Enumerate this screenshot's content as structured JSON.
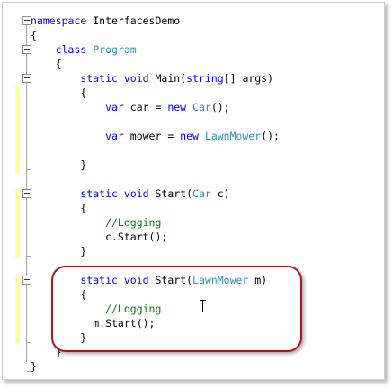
{
  "editor": {
    "lines": [
      {
        "parts": [
          {
            "t": "namespace",
            "c": "kw"
          },
          {
            "t": " InterfacesDemo",
            "c": "plain"
          }
        ]
      },
      {
        "parts": [
          {
            "t": "{",
            "c": "plain"
          }
        ]
      },
      {
        "parts": [
          {
            "t": "    class",
            "c": "kw"
          },
          {
            "t": " ",
            "c": "plain"
          },
          {
            "t": "Program",
            "c": "type"
          }
        ]
      },
      {
        "parts": [
          {
            "t": "    {",
            "c": "plain"
          }
        ]
      },
      {
        "parts": [
          {
            "t": "        static",
            "c": "kw"
          },
          {
            "t": " ",
            "c": "plain"
          },
          {
            "t": "void",
            "c": "kw"
          },
          {
            "t": " Main(",
            "c": "plain"
          },
          {
            "t": "string",
            "c": "kw"
          },
          {
            "t": "[] args)",
            "c": "plain"
          }
        ]
      },
      {
        "parts": [
          {
            "t": "        {",
            "c": "plain"
          }
        ]
      },
      {
        "parts": [
          {
            "t": "            var",
            "c": "kw"
          },
          {
            "t": " car = ",
            "c": "plain"
          },
          {
            "t": "new",
            "c": "kw"
          },
          {
            "t": " ",
            "c": "plain"
          },
          {
            "t": "Car",
            "c": "type"
          },
          {
            "t": "();",
            "c": "plain"
          }
        ]
      },
      {
        "parts": [
          {
            "t": "",
            "c": "plain"
          }
        ]
      },
      {
        "parts": [
          {
            "t": "            var",
            "c": "kw"
          },
          {
            "t": " mower = ",
            "c": "plain"
          },
          {
            "t": "new",
            "c": "kw"
          },
          {
            "t": " ",
            "c": "plain"
          },
          {
            "t": "LawnMower",
            "c": "type"
          },
          {
            "t": "();",
            "c": "plain"
          }
        ]
      },
      {
        "parts": [
          {
            "t": "",
            "c": "plain"
          }
        ]
      },
      {
        "parts": [
          {
            "t": "        }",
            "c": "plain"
          }
        ]
      },
      {
        "parts": [
          {
            "t": "",
            "c": "plain"
          }
        ]
      },
      {
        "parts": [
          {
            "t": "        static",
            "c": "kw"
          },
          {
            "t": " ",
            "c": "plain"
          },
          {
            "t": "void",
            "c": "kw"
          },
          {
            "t": " Start(",
            "c": "plain"
          },
          {
            "t": "Car",
            "c": "type"
          },
          {
            "t": " c)",
            "c": "plain"
          }
        ]
      },
      {
        "parts": [
          {
            "t": "        {",
            "c": "plain"
          }
        ]
      },
      {
        "parts": [
          {
            "t": "            //Logging",
            "c": "comment"
          }
        ]
      },
      {
        "parts": [
          {
            "t": "            c.Start();",
            "c": "plain"
          }
        ]
      },
      {
        "parts": [
          {
            "t": "        }",
            "c": "plain"
          }
        ]
      },
      {
        "parts": [
          {
            "t": "",
            "c": "plain"
          }
        ]
      },
      {
        "parts": [
          {
            "t": "        static",
            "c": "kw"
          },
          {
            "t": " ",
            "c": "plain"
          },
          {
            "t": "void",
            "c": "kw"
          },
          {
            "t": " Start(",
            "c": "plain"
          },
          {
            "t": "LawnMower",
            "c": "type"
          },
          {
            "t": " m)",
            "c": "plain"
          }
        ]
      },
      {
        "parts": [
          {
            "t": "        {",
            "c": "plain"
          }
        ]
      },
      {
        "parts": [
          {
            "t": "            //Logging",
            "c": "comment"
          }
        ]
      },
      {
        "parts": [
          {
            "t": "          m.Start();",
            "c": "plain"
          }
        ]
      },
      {
        "parts": [
          {
            "t": "        }",
            "c": "plain"
          }
        ]
      },
      {
        "parts": [
          {
            "t": "    }",
            "c": "plain"
          }
        ]
      },
      {
        "parts": [
          {
            "t": "}",
            "c": "plain"
          }
        ]
      }
    ]
  },
  "colors": {
    "keyword": "#0000ff",
    "type": "#2b91af",
    "comment": "#008000",
    "highlight_border": "#a8191f",
    "change_bar": "#ffff9c"
  },
  "icons": {
    "fold": "collapse-minus-icon",
    "cursor": "text-ibeam-cursor-icon"
  }
}
